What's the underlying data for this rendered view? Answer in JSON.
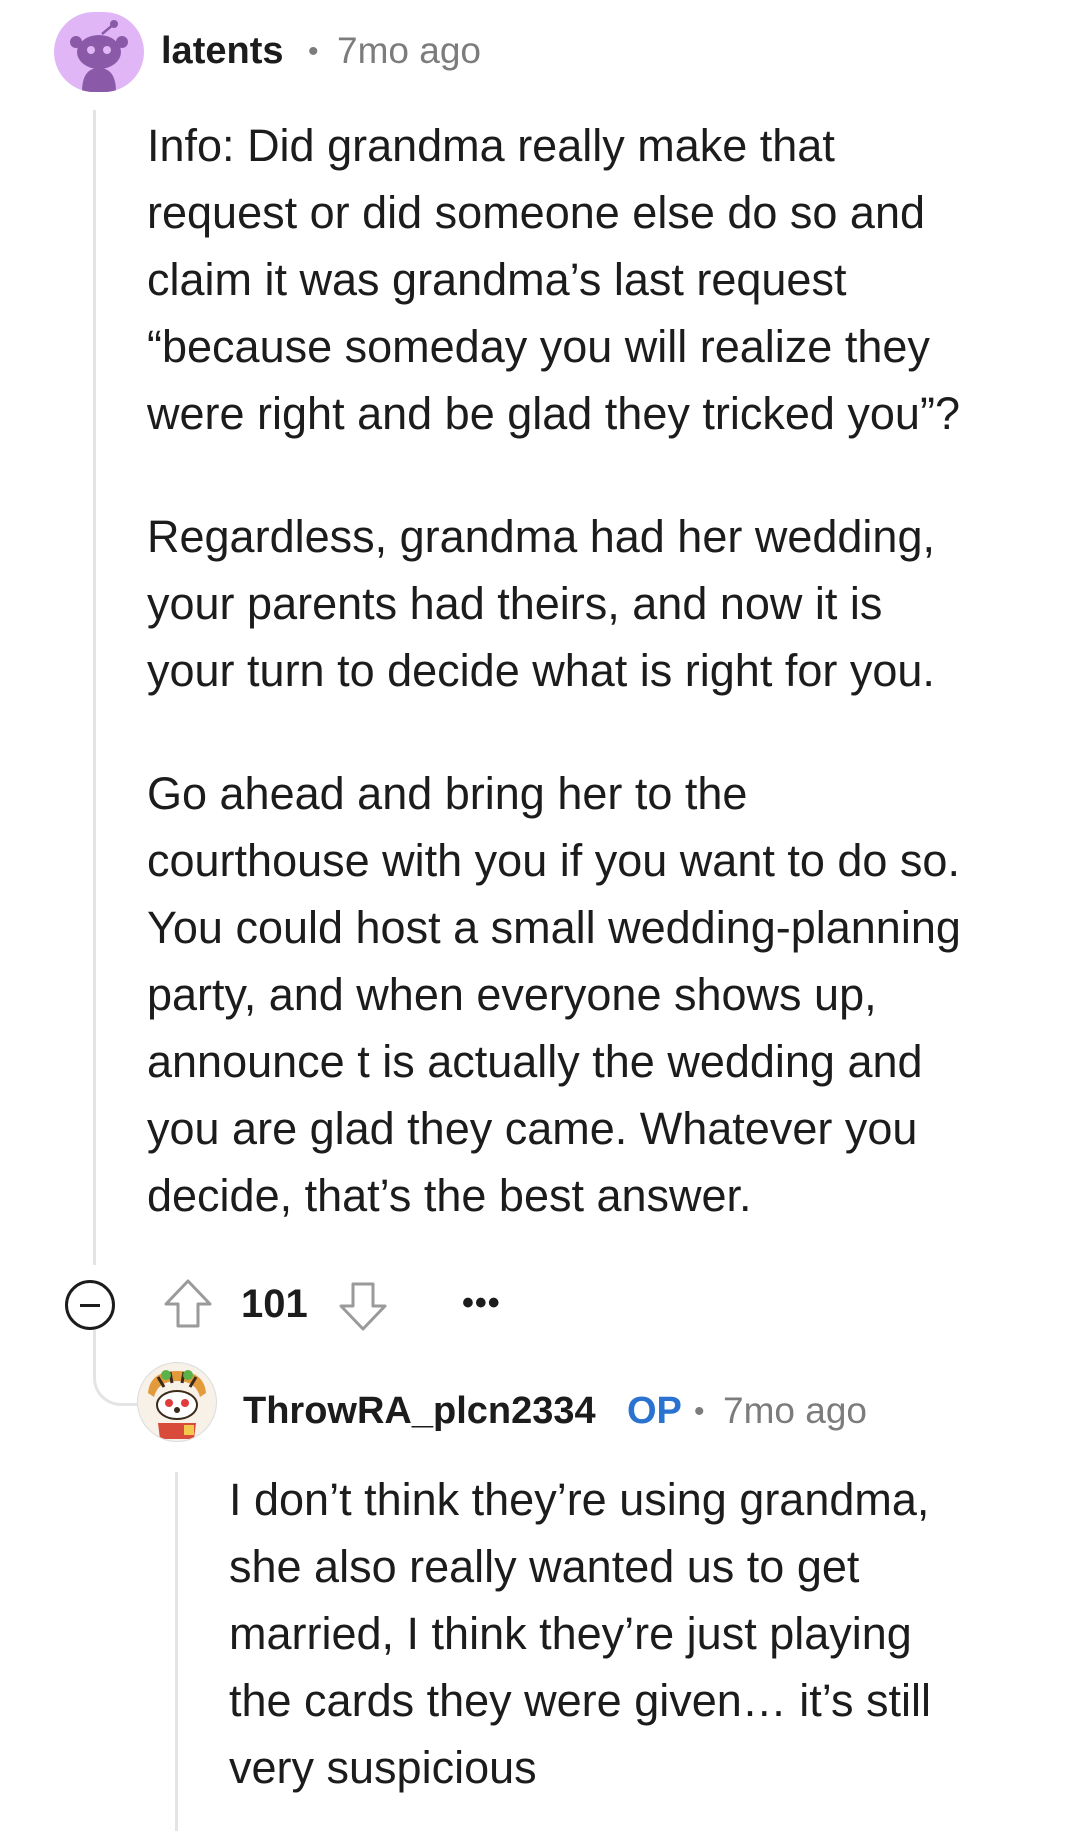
{
  "comment": {
    "author": "latents",
    "time": "7mo ago",
    "separator": "•",
    "paragraphs": [
      "Info: Did grandma really make that\nrequest or did someone else do so and\nclaim it was grandma’s last request\n“because someday you will realize they\nwere right and be glad they tricked you”?",
      "Regardless, grandma had her wedding,\nyour parents had theirs, and now it is\nyour turn to decide what is right for you.",
      "Go ahead and bring her to the\ncourthouse with you if you want to do so.\nYou could host a small wedding-planning\nparty, and when everyone shows up,\nannounce t is actually the wedding and\nyou are glad they came. Whatever you\ndecide, that’s the best answer."
    ],
    "score": "101",
    "more": "•••",
    "icons": {
      "collapse": "minus-circle-icon",
      "upvote": "arrow-up-icon",
      "downvote": "arrow-down-icon",
      "more": "ellipsis-icon"
    }
  },
  "reply": {
    "author": "ThrowRA_plcn2334",
    "badge": "OP",
    "time": "7mo ago",
    "separator": "•",
    "body": "I don’t think they’re using grandma,\nshe also really wanted us to get\nmarried, I think they’re just playing\nthe cards they were given… it’s still\nvery suspicious"
  },
  "colors": {
    "thread_line": "#e2e4e6",
    "avatar1_bg": "#e1b6f6",
    "op_badge": "#2a73d0",
    "meta_gray": "#7c7c7c"
  }
}
